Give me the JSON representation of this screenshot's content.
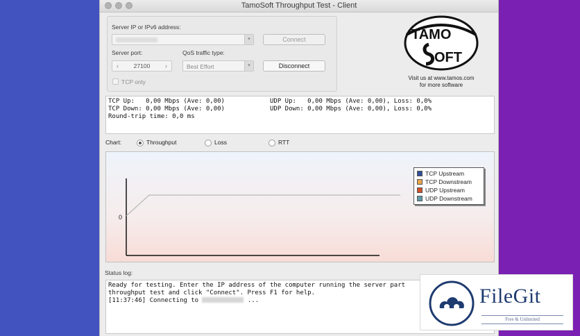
{
  "window": {
    "title": "TamoSoft Throughput Test - Client"
  },
  "server": {
    "ip_label": "Server IP or IPv6  address:",
    "port_label": "Server port:",
    "port_value": "27100",
    "qos_label": "QoS traffic type:",
    "qos_value": "Best Effort",
    "tcp_only_label": "TCP only",
    "connect_label": "Connect",
    "disconnect_label": "Disconnect"
  },
  "logo": {
    "visit_line1": "Visit us at www.tamos.com",
    "visit_line2": "for more software"
  },
  "stats": {
    "tcp_up": "TCP Up:   0,00 Mbps (Ave: 0,00)",
    "udp_up": "UDP Up:   0,00 Mbps (Ave: 0,00), Loss: 0,0%",
    "tcp_down": "TCP Down: 0,00 Mbps (Ave: 0,00)",
    "udp_down": "UDP Down: 0,00 Mbps (Ave: 0,00), Loss: 0,0%",
    "rtt": "Round-trip time: 0,0 ms"
  },
  "chart_controls": {
    "label": "Chart:",
    "options": [
      "Throughput",
      "Loss",
      "RTT"
    ],
    "selected": "Throughput"
  },
  "chart_data": {
    "type": "line",
    "ylabel": "",
    "xlabel": "",
    "y_tick": "0",
    "legend_placement": "top-right",
    "series": [
      {
        "name": "TCP Upstream",
        "color": "#2f4f9a"
      },
      {
        "name": "TCP Downstream",
        "color": "#e8a54a"
      },
      {
        "name": "UDP Upstream",
        "color": "#d0502a"
      },
      {
        "name": "UDP Downstream",
        "color": "#5f9aa8"
      }
    ]
  },
  "status_log": {
    "label": "Status log:",
    "line1": "Ready for testing. Enter the IP address of the computer running the server part",
    "line2": "throughput test and click \"Connect\". Press F1 for help.",
    "line3": "[11:37:46] Connecting to",
    "line3_tail": " ..."
  },
  "watermark": {
    "brand": "FileGit",
    "tagline": "Free & Unlimited"
  }
}
